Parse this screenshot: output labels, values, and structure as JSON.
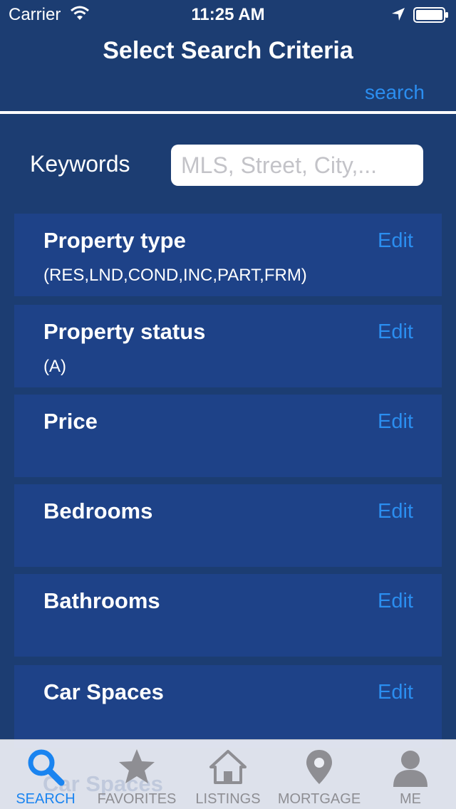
{
  "status_bar": {
    "carrier": "Carrier",
    "time": "11:25 AM",
    "icons": [
      "wifi-icon",
      "location-arrow-icon",
      "battery-icon"
    ]
  },
  "nav": {
    "title": "Select Search Criteria",
    "search_label": "search"
  },
  "keywords": {
    "label": "Keywords",
    "value": "",
    "placeholder": "MLS, Street, City,..."
  },
  "criteria": [
    {
      "title": "Property type",
      "value": "(RES,LND,COND,INC,PART,FRM)",
      "edit_label": "Edit"
    },
    {
      "title": "Property status",
      "value": "(A)",
      "edit_label": "Edit"
    },
    {
      "title": "Price",
      "value": "",
      "edit_label": "Edit"
    },
    {
      "title": "Bedrooms",
      "value": "",
      "edit_label": "Edit"
    },
    {
      "title": "Bathrooms",
      "value": "",
      "edit_label": "Edit"
    },
    {
      "title": "Car Spaces",
      "value": "",
      "edit_label": "Edit"
    }
  ],
  "tab_bar": {
    "obscured_text": "Car Spaces",
    "tabs": [
      {
        "label": "SEARCH",
        "icon": "search-icon",
        "active": true
      },
      {
        "label": "FAVORITES",
        "icon": "star-icon",
        "active": false
      },
      {
        "label": "LISTINGS",
        "icon": "home-icon",
        "active": false
      },
      {
        "label": "MORTGAGE",
        "icon": "map-pin-icon",
        "active": false
      },
      {
        "label": "ME",
        "icon": "person-icon",
        "active": false
      }
    ]
  },
  "colors": {
    "background": "#1c3d72",
    "row_background": "#1e4288",
    "accent": "#2b8ef0",
    "tab_active": "#1a84f0",
    "tab_inactive": "#8e8e93"
  }
}
